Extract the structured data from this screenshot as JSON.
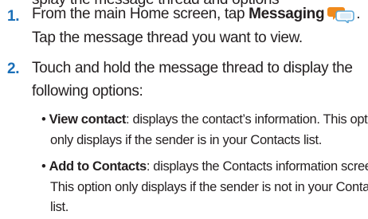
{
  "cut_line": "splay the message thread and options",
  "steps": [
    {
      "number": "1.",
      "line1_pre": "From the main Home screen, tap ",
      "line1_bold": "Messaging",
      "line1_post": ".",
      "line2": "Tap the message thread you want to view.",
      "icon": "messaging-icon"
    },
    {
      "number": "2.",
      "line1": "Touch and hold the message thread to display the",
      "line2": "following options:"
    }
  ],
  "options": [
    {
      "bullet": "•",
      "title": "View contact",
      "line1_rest": ": displays the contact’s information. This option",
      "line2": "only displays if the sender is in your Contacts list."
    },
    {
      "bullet": "•",
      "title": "Add to Contacts",
      "line1_rest": ": displays the Contacts information screen.",
      "line2": "This option only displays if the sender is not in your Contacts",
      "line3": "list."
    }
  ],
  "colors": {
    "step_number": "#1a6fb8",
    "text": "#231f20",
    "icon_orange": "#f08a1c",
    "icon_blue": "#5fa8d8"
  }
}
